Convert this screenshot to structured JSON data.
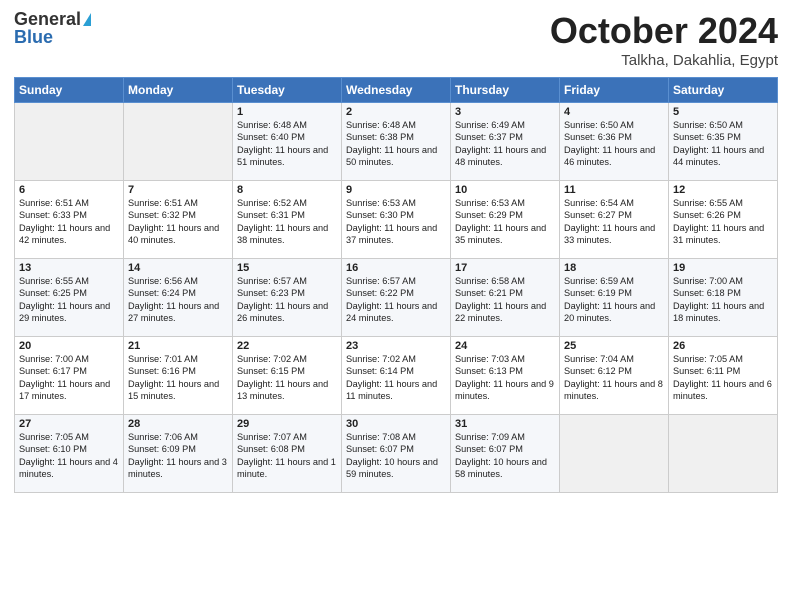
{
  "header": {
    "logo_general": "General",
    "logo_blue": "Blue",
    "title": "October 2024",
    "subtitle": "Talkha, Dakahlia, Egypt"
  },
  "weekdays": [
    "Sunday",
    "Monday",
    "Tuesday",
    "Wednesday",
    "Thursday",
    "Friday",
    "Saturday"
  ],
  "weeks": [
    [
      {
        "day": "",
        "info": ""
      },
      {
        "day": "",
        "info": ""
      },
      {
        "day": "1",
        "info": "Sunrise: 6:48 AM\nSunset: 6:40 PM\nDaylight: 11 hours and 51 minutes."
      },
      {
        "day": "2",
        "info": "Sunrise: 6:48 AM\nSunset: 6:38 PM\nDaylight: 11 hours and 50 minutes."
      },
      {
        "day": "3",
        "info": "Sunrise: 6:49 AM\nSunset: 6:37 PM\nDaylight: 11 hours and 48 minutes."
      },
      {
        "day": "4",
        "info": "Sunrise: 6:50 AM\nSunset: 6:36 PM\nDaylight: 11 hours and 46 minutes."
      },
      {
        "day": "5",
        "info": "Sunrise: 6:50 AM\nSunset: 6:35 PM\nDaylight: 11 hours and 44 minutes."
      }
    ],
    [
      {
        "day": "6",
        "info": "Sunrise: 6:51 AM\nSunset: 6:33 PM\nDaylight: 11 hours and 42 minutes."
      },
      {
        "day": "7",
        "info": "Sunrise: 6:51 AM\nSunset: 6:32 PM\nDaylight: 11 hours and 40 minutes."
      },
      {
        "day": "8",
        "info": "Sunrise: 6:52 AM\nSunset: 6:31 PM\nDaylight: 11 hours and 38 minutes."
      },
      {
        "day": "9",
        "info": "Sunrise: 6:53 AM\nSunset: 6:30 PM\nDaylight: 11 hours and 37 minutes."
      },
      {
        "day": "10",
        "info": "Sunrise: 6:53 AM\nSunset: 6:29 PM\nDaylight: 11 hours and 35 minutes."
      },
      {
        "day": "11",
        "info": "Sunrise: 6:54 AM\nSunset: 6:27 PM\nDaylight: 11 hours and 33 minutes."
      },
      {
        "day": "12",
        "info": "Sunrise: 6:55 AM\nSunset: 6:26 PM\nDaylight: 11 hours and 31 minutes."
      }
    ],
    [
      {
        "day": "13",
        "info": "Sunrise: 6:55 AM\nSunset: 6:25 PM\nDaylight: 11 hours and 29 minutes."
      },
      {
        "day": "14",
        "info": "Sunrise: 6:56 AM\nSunset: 6:24 PM\nDaylight: 11 hours and 27 minutes."
      },
      {
        "day": "15",
        "info": "Sunrise: 6:57 AM\nSunset: 6:23 PM\nDaylight: 11 hours and 26 minutes."
      },
      {
        "day": "16",
        "info": "Sunrise: 6:57 AM\nSunset: 6:22 PM\nDaylight: 11 hours and 24 minutes."
      },
      {
        "day": "17",
        "info": "Sunrise: 6:58 AM\nSunset: 6:21 PM\nDaylight: 11 hours and 22 minutes."
      },
      {
        "day": "18",
        "info": "Sunrise: 6:59 AM\nSunset: 6:19 PM\nDaylight: 11 hours and 20 minutes."
      },
      {
        "day": "19",
        "info": "Sunrise: 7:00 AM\nSunset: 6:18 PM\nDaylight: 11 hours and 18 minutes."
      }
    ],
    [
      {
        "day": "20",
        "info": "Sunrise: 7:00 AM\nSunset: 6:17 PM\nDaylight: 11 hours and 17 minutes."
      },
      {
        "day": "21",
        "info": "Sunrise: 7:01 AM\nSunset: 6:16 PM\nDaylight: 11 hours and 15 minutes."
      },
      {
        "day": "22",
        "info": "Sunrise: 7:02 AM\nSunset: 6:15 PM\nDaylight: 11 hours and 13 minutes."
      },
      {
        "day": "23",
        "info": "Sunrise: 7:02 AM\nSunset: 6:14 PM\nDaylight: 11 hours and 11 minutes."
      },
      {
        "day": "24",
        "info": "Sunrise: 7:03 AM\nSunset: 6:13 PM\nDaylight: 11 hours and 9 minutes."
      },
      {
        "day": "25",
        "info": "Sunrise: 7:04 AM\nSunset: 6:12 PM\nDaylight: 11 hours and 8 minutes."
      },
      {
        "day": "26",
        "info": "Sunrise: 7:05 AM\nSunset: 6:11 PM\nDaylight: 11 hours and 6 minutes."
      }
    ],
    [
      {
        "day": "27",
        "info": "Sunrise: 7:05 AM\nSunset: 6:10 PM\nDaylight: 11 hours and 4 minutes."
      },
      {
        "day": "28",
        "info": "Sunrise: 7:06 AM\nSunset: 6:09 PM\nDaylight: 11 hours and 3 minutes."
      },
      {
        "day": "29",
        "info": "Sunrise: 7:07 AM\nSunset: 6:08 PM\nDaylight: 11 hours and 1 minute."
      },
      {
        "day": "30",
        "info": "Sunrise: 7:08 AM\nSunset: 6:07 PM\nDaylight: 10 hours and 59 minutes."
      },
      {
        "day": "31",
        "info": "Sunrise: 7:09 AM\nSunset: 6:07 PM\nDaylight: 10 hours and 58 minutes."
      },
      {
        "day": "",
        "info": ""
      },
      {
        "day": "",
        "info": ""
      }
    ]
  ]
}
